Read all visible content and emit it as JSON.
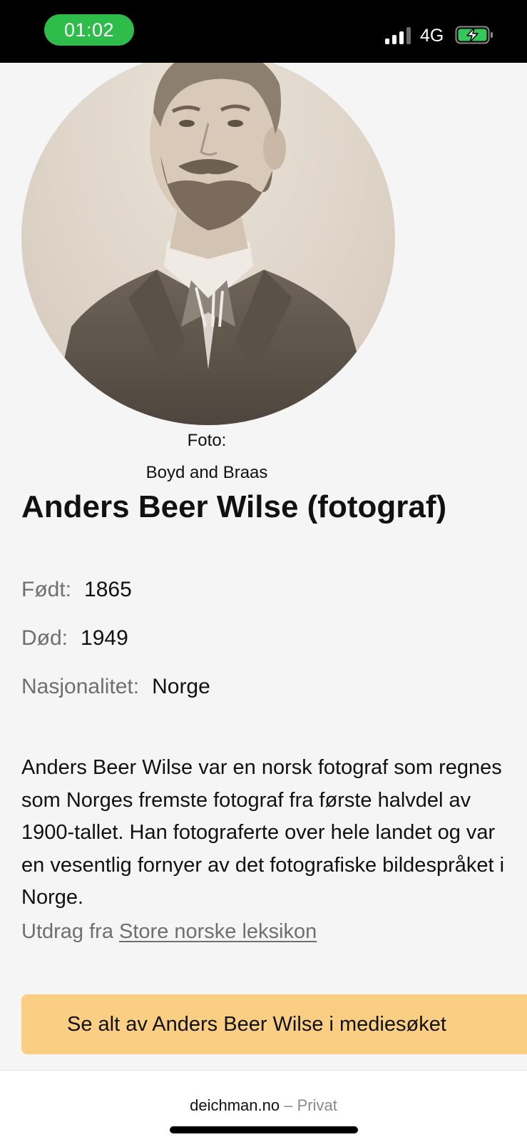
{
  "status_bar": {
    "time": "01:02",
    "network": "4G",
    "signal_bars_active": 3,
    "battery_charging": true,
    "pill_color": "#2ebd4a"
  },
  "portrait": {
    "credit_label": "Foto:",
    "credit_name": "Boyd and Braas"
  },
  "person": {
    "title": "Anders Beer Wilse (fotograf)",
    "facts": [
      {
        "label": "Født:",
        "value": "1865"
      },
      {
        "label": "Død:",
        "value": "1949"
      },
      {
        "label": "Nasjonalitet:",
        "value": "Norge"
      }
    ],
    "description": "Anders Beer Wilse var en norsk fotograf som regnes som Norges fremste fotograf fra første halvdel av 1900-tallet. Han fotograferte over hele landet og var en vesentlig fornyer av det fotografiske bildespråket i Norge.",
    "source_prefix": "Utdrag fra",
    "source_link": "Store norske leksikon"
  },
  "actions": {
    "media_search_label": "Se alt av Anders Beer Wilse i mediesøket",
    "accent_color": "#fbcf83"
  },
  "browser": {
    "domain": "deichman.no",
    "mode": "– Privat"
  }
}
